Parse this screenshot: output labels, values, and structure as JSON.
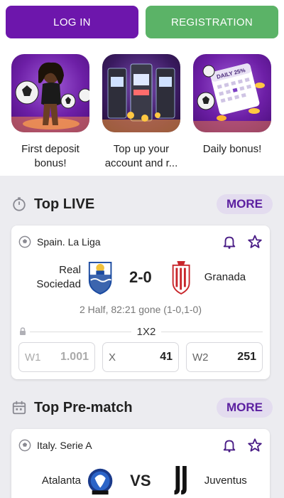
{
  "auth": {
    "login_label": "LOG IN",
    "register_label": "REGISTRATION"
  },
  "colors": {
    "primary": "#6d16ac",
    "register": "#5bb367",
    "accent_text": "#5b1fa0",
    "more_bg": "#e3dcef"
  },
  "promos": [
    {
      "label": "First deposit bonus!",
      "icon": "woman-soccer-promo"
    },
    {
      "label": "Top up your account and r...",
      "icon": "slot-machines-promo"
    },
    {
      "label": "Daily bonus!",
      "icon": "daily-calendar-promo",
      "calendar_text": "DAILY 25%"
    }
  ],
  "top_live": {
    "title": "Top LIVE",
    "more_label": "MORE",
    "match": {
      "league": "Spain. La Liga",
      "home": "Real Sociedad",
      "away": "Granada",
      "score": "2-0",
      "status": "2 Half, 82:21 gone (1-0,1-0)",
      "market": "1X2",
      "odds": [
        {
          "key": "W1",
          "value": "1.001",
          "locked": true
        },
        {
          "key": "X",
          "value": "41",
          "locked": false
        },
        {
          "key": "W2",
          "value": "251",
          "locked": false
        }
      ]
    }
  },
  "top_prematch": {
    "title": "Top Pre-match",
    "more_label": "MORE",
    "match": {
      "league": "Italy. Serie A",
      "home": "Atalanta",
      "away": "Juventus",
      "vs": "VS"
    }
  }
}
